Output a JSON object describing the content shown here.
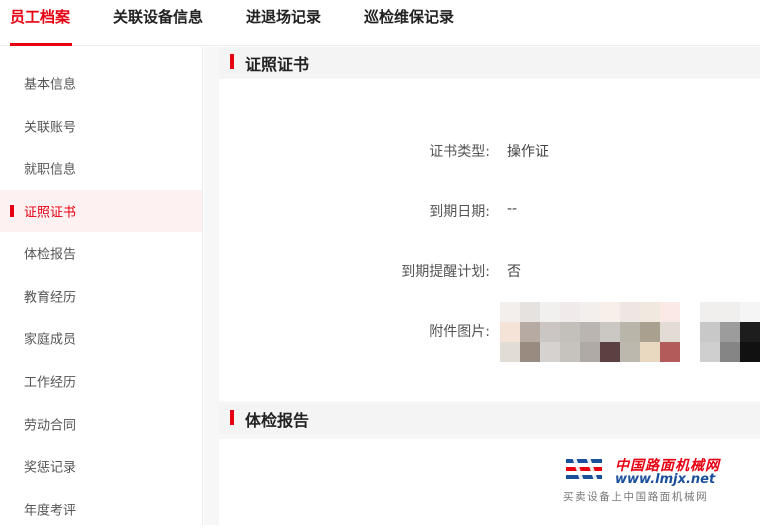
{
  "top_tabs": [
    {
      "label": "员工档案",
      "active": true
    },
    {
      "label": "关联设备信息",
      "active": false
    },
    {
      "label": "进退场记录",
      "active": false
    },
    {
      "label": "巡检维保记录",
      "active": false
    }
  ],
  "sidebar": {
    "items": [
      {
        "label": "基本信息"
      },
      {
        "label": "关联账号"
      },
      {
        "label": "就职信息"
      },
      {
        "label": "证照证书",
        "active": true
      },
      {
        "label": "体检报告"
      },
      {
        "label": "教育经历"
      },
      {
        "label": "家庭成员"
      },
      {
        "label": "工作经历"
      },
      {
        "label": "劳动合同"
      },
      {
        "label": "奖惩记录"
      },
      {
        "label": "年度考评"
      }
    ]
  },
  "certificate": {
    "title": "证照证书",
    "fields": [
      {
        "label": "证书类型:",
        "value": "操作证"
      },
      {
        "label": "到期日期:",
        "value": "--"
      },
      {
        "label": "到期提醒计划:",
        "value": "否"
      },
      {
        "label": "附件图片:",
        "value": ""
      }
    ],
    "attachments": [
      {
        "colors": [
          "#f3efec",
          "#e6e2df",
          "#f1f0ee",
          "#f4e3d6",
          "#b7aaa3",
          "#cbc6c3",
          "#e1dcd5",
          "#9a8b80",
          "#d5d2cf"
        ]
      },
      {
        "colors": [
          "#f0eaea",
          "#f3efec",
          "#f6efea",
          "#c3bfbb",
          "#bab5b0",
          "#cbc7c2",
          "#c6c3bf",
          "#b0aaa6",
          "#5c4142"
        ]
      },
      {
        "colors": [
          "#ede6e3",
          "#f1e8e0",
          "#fae9e4",
          "#b9b5a9",
          "#aaa08f",
          "#e3dcd5",
          "#bdb8ad",
          "#ead9c1",
          "#b35a5a"
        ]
      },
      {
        "colors": [
          "#f0efee",
          "#f0efee",
          "#f5f5f5",
          "#c8c8c8",
          "#9c9c9c",
          "#1d1d1d",
          "#cfcfcf",
          "#858585",
          "#111111"
        ]
      }
    ]
  },
  "medical": {
    "title": "体检报告"
  },
  "watermark": {
    "name_cn": "中国路面机械网",
    "url": "www.lmjx.net",
    "tagline": "买卖设备上中国路面机械网"
  }
}
